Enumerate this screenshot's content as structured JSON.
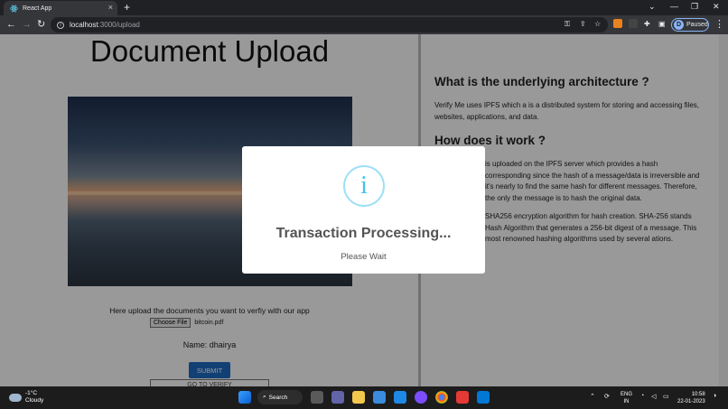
{
  "browser": {
    "tab_title": "React App",
    "tab_close": "×",
    "new_tab": "+",
    "window_controls": [
      "⌄",
      "—",
      "❐",
      "✕"
    ],
    "url_host": "localhost",
    "url_path": ":3000/upload",
    "profile_initial": "D",
    "profile_status": "Paused"
  },
  "page": {
    "title": "Document Upload",
    "upload_instructions": "Here upload the documents you want to verfiy with our app",
    "choose_file_label": "Choose File",
    "file_name": "bitcoin.pdf",
    "name_line": "Name: dhairya",
    "submit_label": "SUBMIT",
    "verify_label": "GO TO VERIFY"
  },
  "info": {
    "heading_architecture": "What is the underlying architecture ?",
    "para_architecture": "Verify Me uses IPFS which a is a distributed system for storing and accessing files, websites, applications, and data.",
    "heading_how": "How does it work ?",
    "para_how_1": "is uploaded on the IPFS server which provides a hash corresponding   since the hash of a message/data is irreversible and it's nearly   to find the same hash for different messages. Therefore, the only   the message is to hash the original data.",
    "para_how_2": "   SHA256 encryption algorithm for hash creation. SHA-256 stands   Hash Algorithm that generates a 256-bit digest of a message. This   most renowned hashing algorithms used by several   ations."
  },
  "modal": {
    "icon": "i",
    "title": "Transaction Processing...",
    "text": "Please Wait"
  },
  "taskbar": {
    "temperature": "-1°C",
    "condition": "Cloudy",
    "search_label": "Search",
    "lang_1": "ENG",
    "lang_2": "IN",
    "time": "10:58",
    "date": "22-01-2023"
  }
}
